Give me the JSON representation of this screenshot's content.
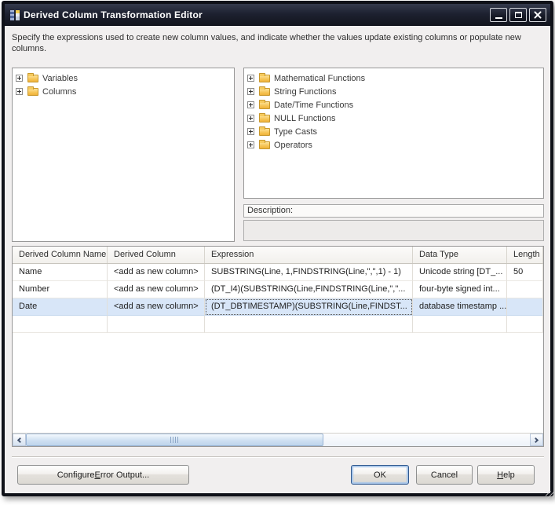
{
  "window": {
    "title": "Derived Column Transformation Editor"
  },
  "header": {
    "description": "Specify the expressions used to create new column values, and indicate whether the values update existing columns or populate new columns."
  },
  "left_tree": {
    "items": [
      {
        "label": "Variables"
      },
      {
        "label": "Columns"
      }
    ]
  },
  "right_tree": {
    "items": [
      {
        "label": "Mathematical Functions"
      },
      {
        "label": "String Functions"
      },
      {
        "label": "Date/Time Functions"
      },
      {
        "label": "NULL Functions"
      },
      {
        "label": "Type Casts"
      },
      {
        "label": "Operators"
      }
    ]
  },
  "description_panel": {
    "label": "Description:",
    "content": ""
  },
  "grid": {
    "columns": [
      "Derived Column Name",
      "Derived Column",
      "Expression",
      "Data Type",
      "Length"
    ],
    "rows": [
      {
        "name": "Name",
        "derived": "<add as new column>",
        "expression": "SUBSTRING(Line, 1,FINDSTRING(Line,\",\",1) - 1)",
        "type": "Unicode string [DT_...",
        "length": "50"
      },
      {
        "name": "Number",
        "derived": "<add as new column>",
        "expression": "(DT_I4)(SUBSTRING(Line,FINDSTRING(Line,\",\"...",
        "type": "four-byte signed int...",
        "length": ""
      },
      {
        "name": "Date",
        "derived": "<add as new column>",
        "expression": "(DT_DBTIMESTAMP)(SUBSTRING(Line,FINDST...",
        "type": "database timestamp ...",
        "length": ""
      }
    ],
    "selected_row": "Date"
  },
  "buttons": {
    "configure_error_output": {
      "pre": "Configure ",
      "key": "E",
      "post": "rror Output..."
    },
    "ok": "OK",
    "cancel": "Cancel",
    "help": {
      "key": "H",
      "post": "elp"
    }
  },
  "colors": {
    "titlebar": "#1d2130",
    "selection": "#d8e6f8",
    "folder": "#f5bf4b",
    "ok_focus_border": "#2f578d"
  }
}
